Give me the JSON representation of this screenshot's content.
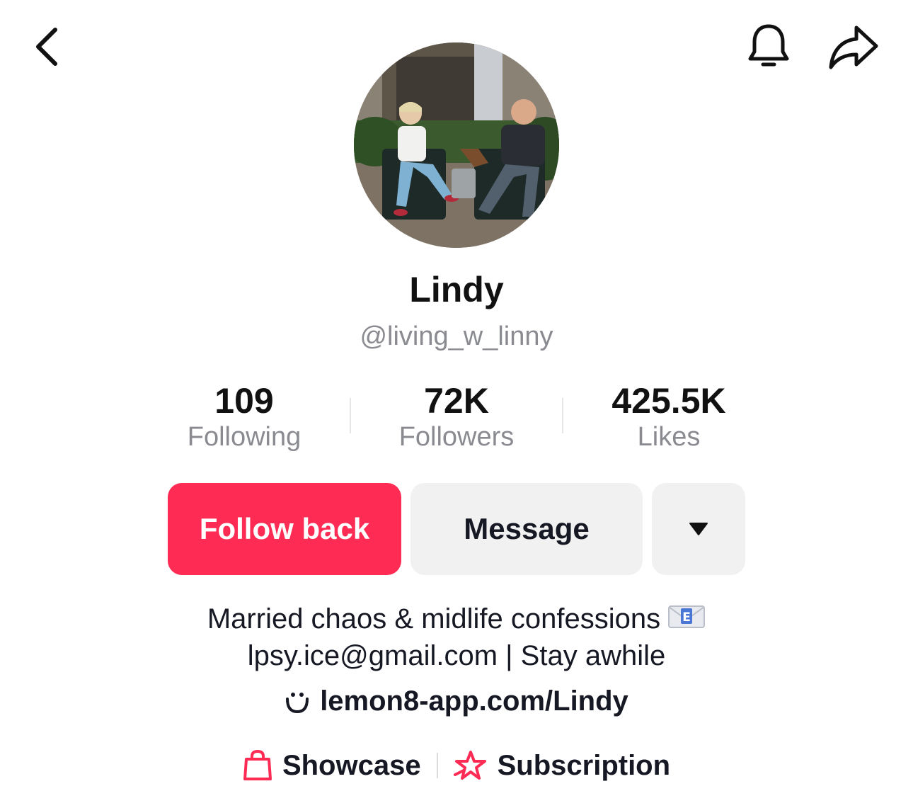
{
  "header": {
    "back_icon": "chevron-left-icon",
    "bell_icon": "bell-icon",
    "share_icon": "share-arrow-icon"
  },
  "profile": {
    "display_name": "Lindy",
    "handle": "@living_w_linny"
  },
  "stats": [
    {
      "value": "109",
      "label": "Following"
    },
    {
      "value": "72K",
      "label": "Followers"
    },
    {
      "value": "425.5K",
      "label": "Likes"
    }
  ],
  "actions": {
    "follow_label": "Follow back",
    "message_label": "Message",
    "more_icon": "caret-down-icon"
  },
  "bio": {
    "line1": "Married chaos & midlife confessions",
    "line2": "lpsy.ice@gmail.com | Stay awhile",
    "link": "lemon8-app.com/Lindy"
  },
  "bottom": {
    "showcase_label": "Showcase",
    "subscription_label": "Subscription"
  },
  "colors": {
    "accent": "#fe2c55",
    "secondary_button": "#f1f1f2",
    "muted_text": "#8a8b91"
  }
}
